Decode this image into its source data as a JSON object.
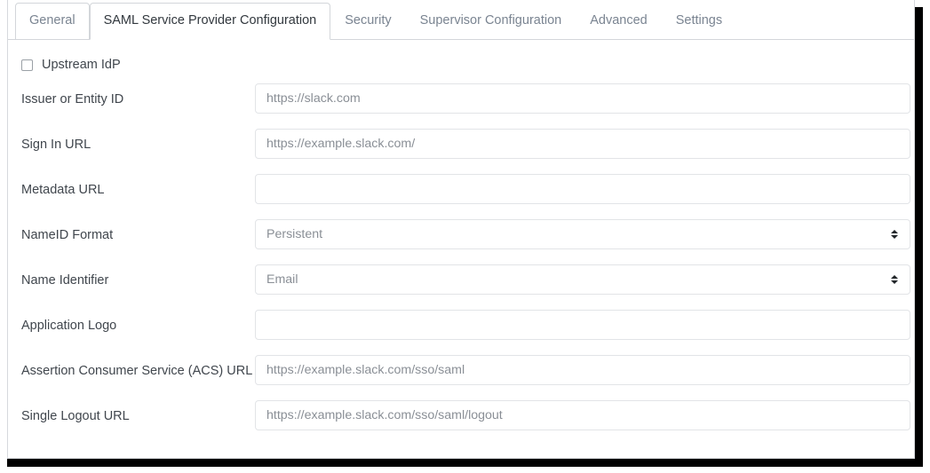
{
  "tabs": [
    {
      "label": "General",
      "state": "bordered"
    },
    {
      "label": "SAML Service Provider Configuration",
      "state": "active"
    },
    {
      "label": "Security",
      "state": "normal"
    },
    {
      "label": "Supervisor Configuration",
      "state": "normal"
    },
    {
      "label": "Advanced",
      "state": "normal"
    },
    {
      "label": "Settings",
      "state": "normal"
    }
  ],
  "upstream_idp": {
    "label": "Upstream IdP",
    "checked": false
  },
  "fields": [
    {
      "label": "Issuer or Entity ID",
      "type": "text",
      "value": "https://slack.com",
      "placeholder": "https://slack.com"
    },
    {
      "label": "Sign In URL",
      "type": "text",
      "value": "https://example.slack.com/",
      "placeholder": "https://example.slack.com/"
    },
    {
      "label": "Metadata URL",
      "type": "text",
      "value": "",
      "placeholder": ""
    },
    {
      "label": "NameID Format",
      "type": "select",
      "value": "Persistent",
      "placeholder": ""
    },
    {
      "label": "Name Identifier",
      "type": "select",
      "value": "Email",
      "placeholder": ""
    },
    {
      "label": "Application Logo",
      "type": "text",
      "value": "",
      "placeholder": ""
    },
    {
      "label": "Assertion Consumer Service (ACS) URL",
      "type": "text",
      "value": "https://example.slack.com/sso/saml",
      "placeholder": "https://example.slack.com/sso/saml"
    },
    {
      "label": "Single Logout URL",
      "type": "text",
      "value": "https://example.slack.com/sso/saml/logout",
      "placeholder": "https://example.slack.com/sso/saml/logout"
    }
  ],
  "colors": {
    "tab_active_text": "#32383e",
    "tab_inactive_text": "#7a8491",
    "label_text": "#40464d",
    "input_text": "#8a8f96",
    "border": "#d3d6da",
    "input_border": "#e2e4e7"
  }
}
